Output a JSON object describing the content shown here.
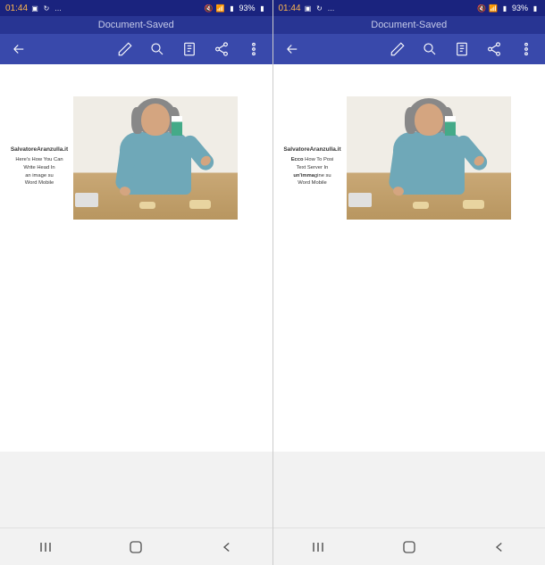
{
  "status": {
    "time": "01:44",
    "battery": "93%"
  },
  "app": {
    "title": "Document-Saved"
  },
  "left_doc": {
    "site": "SalvatoreAranzulla.it",
    "line1": "Here's How You Can",
    "line2": "Write Head In",
    "line3": "an image su",
    "line4": "Word Mobile"
  },
  "right_doc": {
    "site": "SalvatoreAranzulla.it",
    "prefix": "Ecco",
    "line1": "How To Posi",
    "line2": "Text Server In",
    "bold3": "un'imma",
    "suffix3": "gine su",
    "line4": "Word Mobile"
  }
}
